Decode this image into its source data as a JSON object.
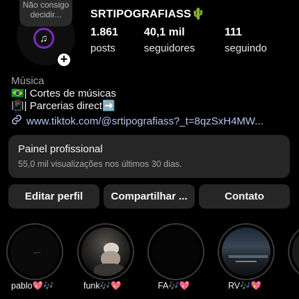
{
  "profile": {
    "note": "Não consigo decidir...",
    "username": "SRTIPOGRAFIASS",
    "username_emoji": "🌵",
    "avatar_music_glyph": "♫",
    "add_glyph": "+"
  },
  "stats": [
    {
      "value": "1.861",
      "label": "posts"
    },
    {
      "value": "40,1 mil",
      "label": "seguidores"
    },
    {
      "value": "111",
      "label": "seguindo"
    }
  ],
  "bio": {
    "category": "Música",
    "lines": [
      "🇧🇷| Cortes de músicas",
      "📳| Parcerias direct➡️"
    ],
    "link": "www.tiktok.com/@srtipografiass?_t=8qzSxH4MW..."
  },
  "panel": {
    "title": "Painel profissional",
    "subtitle": "55,0 mil visualizações nos últimos 30 dias."
  },
  "buttons": {
    "edit": "Editar perfil",
    "share": "Compartilhar ...",
    "contact": "Contato"
  },
  "highlights": [
    {
      "label": "pablo💖🎶"
    },
    {
      "label": "funk🎶💖"
    },
    {
      "label": "FA🎶💖"
    },
    {
      "label": "RV🎶💖"
    }
  ],
  "colors": {
    "background": "#000000",
    "surface": "#262626",
    "link": "#b7c6f4",
    "avatar_ring": "#7b2cbf"
  },
  "icons": {
    "link": "link-icon",
    "music": "music-note-icon",
    "add": "plus-icon"
  }
}
